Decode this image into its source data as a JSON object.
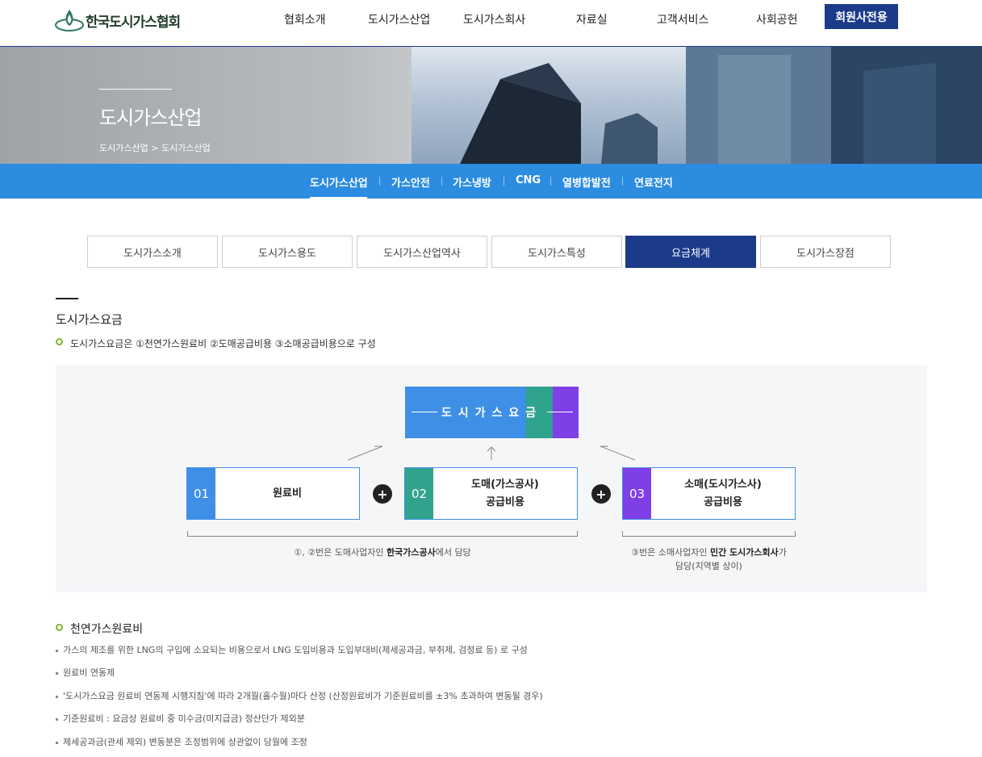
{
  "header": {
    "logo_text": "한국도시가스협회",
    "nav": [
      "협회소개",
      "도시가스산업",
      "도시가스회사",
      "자료실",
      "고객서비스",
      "사회공헌"
    ],
    "member_button": "회원사전용"
  },
  "hero": {
    "title": "도시가스산업",
    "breadcrumb_parent": "도시가스산업",
    "breadcrumb_sep": ">",
    "breadcrumb_current": "도시가스산업"
  },
  "subnav": [
    "도시가스산업",
    "가스안전",
    "가스냉방",
    "CNG",
    "열병합발전",
    "연료전지"
  ],
  "tabs": {
    "items": [
      "도시가스소개",
      "도시가스용도",
      "도시가스산업역사",
      "도시가스특성",
      "요금체계",
      "도시가스장점"
    ],
    "active_index": 4
  },
  "section": {
    "title": "도시가스요금",
    "intro": "도시가스요금은 ①천연가스원료비 ②도매공급비용 ③소매공급비용으로 구성"
  },
  "diagram": {
    "top_label": "도시가스요금",
    "components": [
      {
        "num": "01",
        "line1": "원료비",
        "line2": "",
        "color": "#3f8fe6"
      },
      {
        "num": "02",
        "line1": "도매(가스공사)",
        "line2": "공급비용",
        "color": "#2fa38d"
      },
      {
        "num": "03",
        "line1": "소매(도시가스사)",
        "line2": "공급비용",
        "color": "#7f3fe6"
      }
    ],
    "plus": "+",
    "note_left_pre": "①, ②번은 도매사업자인 ",
    "note_left_bold": "한국가스공사",
    "note_left_post": "에서 담당",
    "note_right_pre": "③번은 소매사업자인 ",
    "note_right_bold": "민간 도시가스회사",
    "note_right_post": "가",
    "note_right_line2": "담당(지역별 상이)"
  },
  "section2": {
    "title": "천연가스원료비",
    "items": [
      "가스의 제조를 위한 LNG의 구입에 소요되는 비용으로서 LNG 도입비용과 도입부대비(제세공과금, 부취제, 검정료 등) 로 구성",
      "원료비 연동제",
      "'도시가스요금 원료비 연동제 시행지침'에 따라 2개월(홀수월)마다 산정 (산정원료비가 기준원료비를 ±3% 초과하여 변동될 경우)",
      "기준원료비 : 요금상 원료비 중 미수금(미지급금) 정산단가 제외분",
      "제세공과금(관세 제외) 변동분은 조정범위에 상관없이 당월에 조정"
    ]
  }
}
